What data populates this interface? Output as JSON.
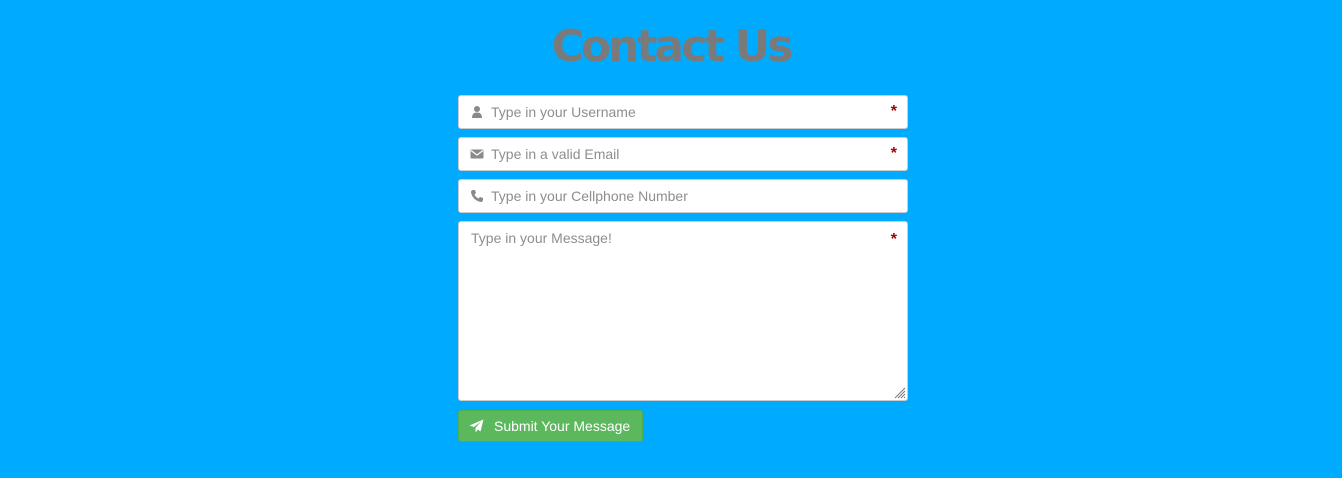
{
  "page": {
    "title": "Contact Us",
    "background_color": "#00abff",
    "accent_required_color": "#a50000",
    "submit_color": "#5cb85c"
  },
  "form": {
    "username": {
      "icon": "user-icon",
      "placeholder": "Type in your Username",
      "required_marker": "*"
    },
    "email": {
      "icon": "envelope-icon",
      "placeholder": "Type in a valid Email",
      "required_marker": "*"
    },
    "phone": {
      "icon": "phone-icon",
      "placeholder": "Type in your Cellphone Number"
    },
    "message": {
      "placeholder": "Type in your Message!",
      "required_marker": "*"
    },
    "submit": {
      "icon": "paper-plane-icon",
      "label": "Submit Your Message"
    }
  }
}
